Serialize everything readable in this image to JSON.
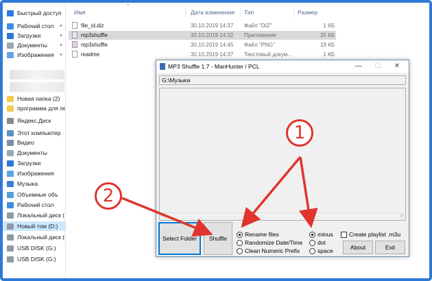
{
  "explorer": {
    "sidebar": {
      "items": [
        {
          "label": "Быстрый доступ",
          "icon": "star-icon",
          "color": "#2c7be5"
        },
        {
          "label": "Рабочий стол",
          "icon": "desktop-icon",
          "color": "#3c8ee0"
        },
        {
          "label": "Загрузки",
          "icon": "download-icon",
          "color": "#2a79d6"
        },
        {
          "label": "Документы",
          "icon": "documents-icon",
          "color": "#9aa7b8"
        },
        {
          "label": "Изображения",
          "icon": "pictures-icon",
          "color": "#5fa3e6"
        },
        {
          "label": "Новая папка (2)",
          "icon": "folder-icon",
          "color": "#f3c94e"
        },
        {
          "label": "программа для пе",
          "icon": "folder-icon",
          "color": "#f3c94e"
        },
        {
          "label": "Яндекс.Диск",
          "icon": "yandex-disk-icon",
          "color": "#8a8a8a"
        },
        {
          "label": "Этот компьютер",
          "icon": "computer-icon",
          "color": "#5f8fbf"
        },
        {
          "label": "Видео",
          "icon": "video-icon",
          "color": "#7a8fa8"
        },
        {
          "label": "Документы",
          "icon": "documents-icon",
          "color": "#9aa7b8"
        },
        {
          "label": "Загрузки",
          "icon": "download-icon",
          "color": "#2a79d6"
        },
        {
          "label": "Изображения",
          "icon": "pictures-icon",
          "color": "#5fa3e6"
        },
        {
          "label": "Музыка",
          "icon": "music-icon",
          "color": "#3b7fd0"
        },
        {
          "label": "Объемные объ",
          "icon": "3d-objects-icon",
          "color": "#4aa0e0"
        },
        {
          "label": "Рабочий стол",
          "icon": "desktop-icon",
          "color": "#3c8ee0"
        },
        {
          "label": "Локальный диск (",
          "icon": "drive-icon",
          "color": "#8f9aa6"
        },
        {
          "label": "Новый том (D:)",
          "icon": "drive-icon",
          "color": "#8f9aa6"
        },
        {
          "label": "Локальный диск (I",
          "icon": "drive-icon",
          "color": "#8f9aa6"
        },
        {
          "label": "USB DISK (G:)",
          "icon": "usb-drive-icon",
          "color": "#8f9aa6"
        },
        {
          "label": "USB DISK (G:)",
          "icon": "usb-drive-icon",
          "color": "#8f9aa6"
        }
      ]
    },
    "columns": {
      "name": "Имя",
      "date": "Дата изменения",
      "type": "Тип",
      "size": "Размер"
    },
    "files": [
      {
        "name": "file_id.diz",
        "date": "30.10.2019 14:37",
        "type": "Файл \"DIZ\"",
        "size": "1 КБ"
      },
      {
        "name": "mp3shuffle",
        "date": "30.10.2019 14:32",
        "type": "Приложение",
        "size": "25 КБ"
      },
      {
        "name": "mp3shuffle",
        "date": "30.10.2019 14:45",
        "type": "Файл \"PNG\"",
        "size": "19 КБ"
      },
      {
        "name": "readme",
        "date": "30.10.2019 14:37",
        "type": "Текстовый докум...",
        "size": "1 КБ"
      }
    ]
  },
  "app": {
    "title": "MP3 Shuffle 1.7 - ManHunter / PCL",
    "controls": {
      "minimize": "—",
      "maximize": "☐",
      "close": "✕"
    },
    "path": "G:\\Музыка",
    "buttons": {
      "select_folder": "Select Folder",
      "shuffle": "Shuffle",
      "about": "About",
      "exit": "Exit"
    },
    "rename_options": [
      "Rename files",
      "Randomize Date/Time",
      "Clean Numeric Prefix"
    ],
    "separator_options": [
      "minus",
      "dot",
      "space"
    ],
    "create_playlist": "Create playlist .m3u",
    "scroll_left": "<",
    "scroll_right": ">"
  },
  "annotations": {
    "one": "1",
    "two": "2",
    "color": "#e0342c"
  }
}
